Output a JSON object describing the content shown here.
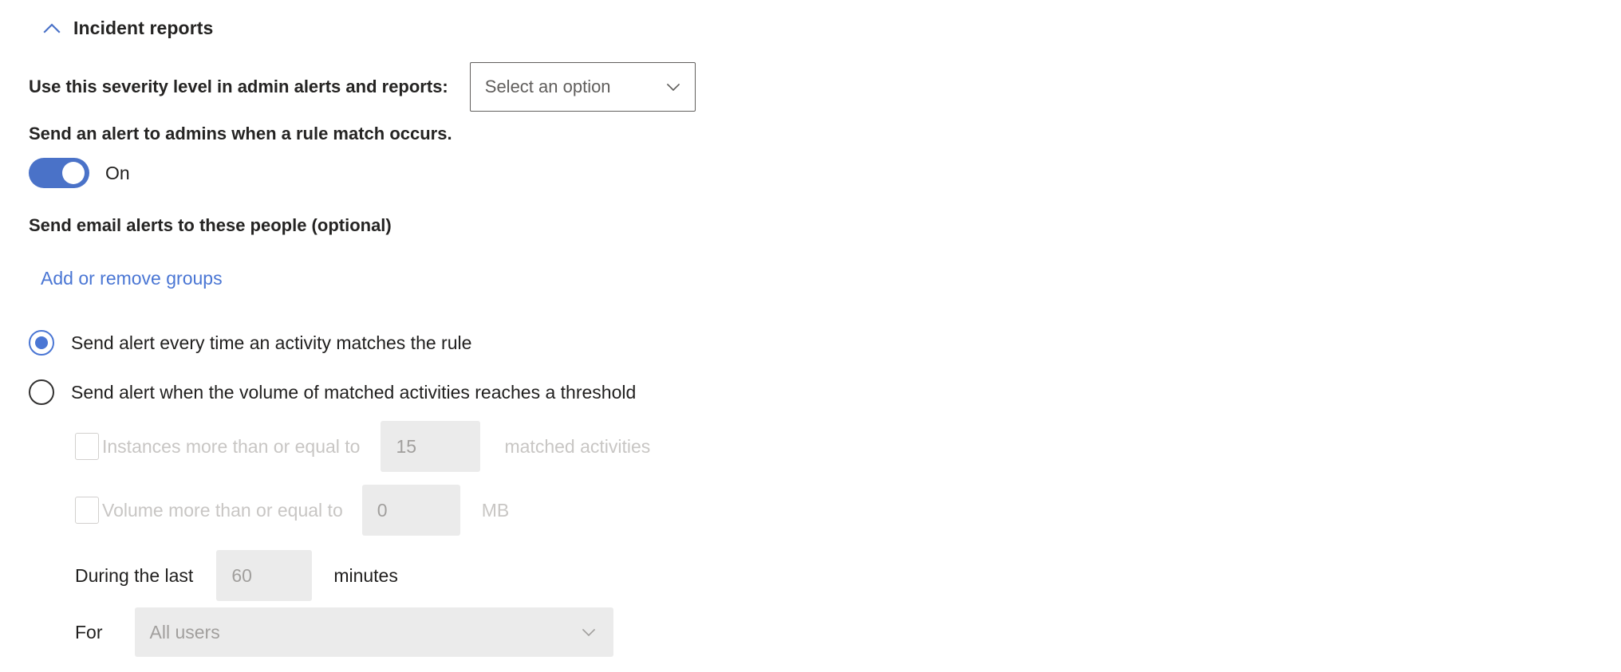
{
  "section": {
    "title": "Incident reports",
    "collapse_icon": "chevron-up-icon",
    "accent_color": "#4a72c8"
  },
  "severity": {
    "label": "Use this severity level in admin alerts and reports:",
    "dropdown_value": "Select an option",
    "dropdown_icon": "chevron-down-icon"
  },
  "admin_alert": {
    "label": "Send an alert to admins when a rule match occurs.",
    "toggle_state": "On",
    "toggle_on": true,
    "toggle_color": "#4a72c8"
  },
  "email_alerts": {
    "label": "Send email alerts to these people (optional)",
    "link_text": "Add or remove groups",
    "link_color": "#4a76d4"
  },
  "alert_mode": {
    "options": [
      {
        "label": "Send alert every time an activity matches the rule",
        "selected": true
      },
      {
        "label": "Send alert when the volume of matched activities reaches a threshold",
        "selected": false
      }
    ]
  },
  "threshold": {
    "instances": {
      "checkbox_label": "Instances more than or equal to",
      "checked": false,
      "value": "15",
      "unit": "matched activities"
    },
    "volume": {
      "checkbox_label": "Volume more than or equal to",
      "checked": false,
      "value": "0",
      "unit": "MB"
    },
    "during": {
      "label": "During the last",
      "value": "60",
      "unit": "minutes"
    },
    "for": {
      "label": "For",
      "dropdown_value": "All users",
      "dropdown_icon": "chevron-down-icon"
    }
  }
}
